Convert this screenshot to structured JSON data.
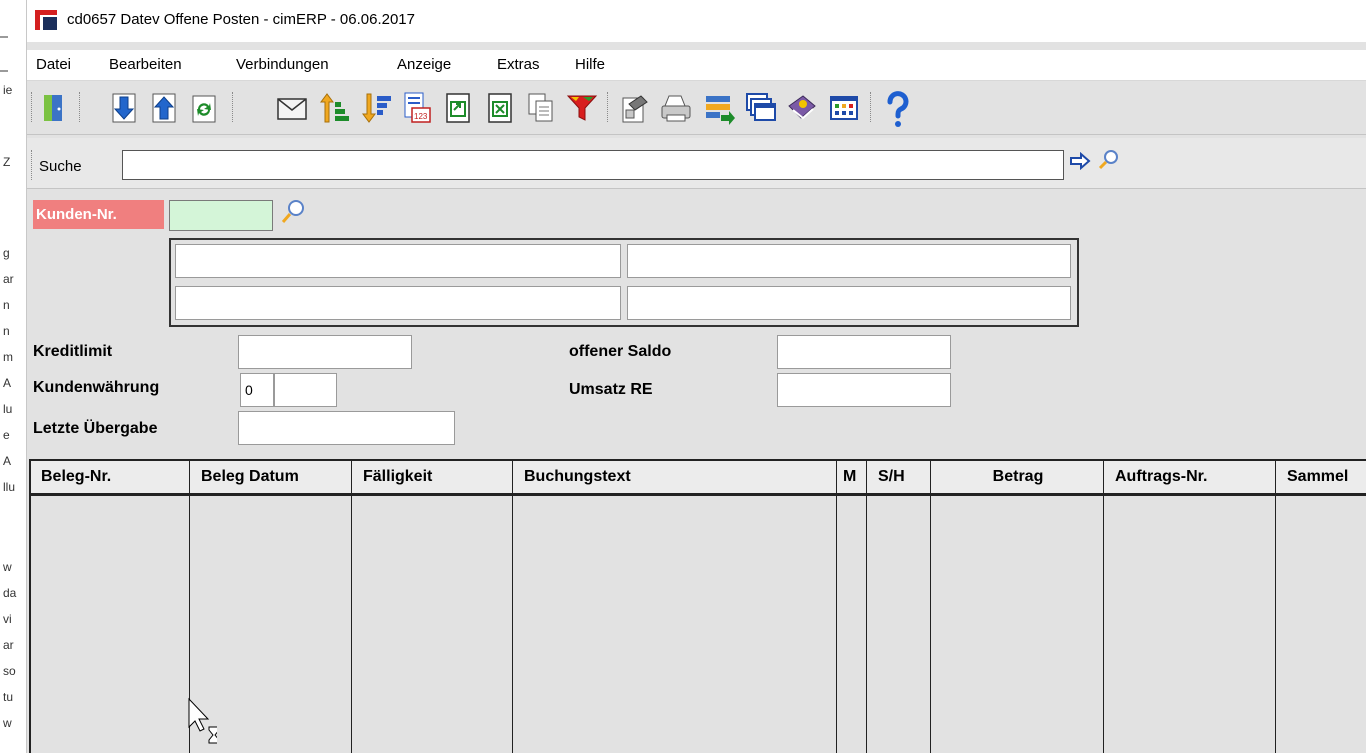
{
  "window": {
    "title": "cd0657 Datev Offene Posten - cimERP - 06.06.2017"
  },
  "menu": [
    "Datei",
    "Bearbeiten",
    "Verbindungen",
    "Anzeige",
    "Extras",
    "Hilfe"
  ],
  "toolbar": {
    "icons": [
      "exit-door-icon",
      "record-down-icon",
      "record-up-icon",
      "refresh-icon",
      "mail-icon",
      "sort-ascending-icon",
      "sort-descending-icon",
      "calendar-list-icon",
      "export-icon",
      "excel-export-icon",
      "copy-icon",
      "filter-icon",
      "properties-icon",
      "print-icon",
      "transfer-icon",
      "windows-icon",
      "book-icon",
      "table-icon",
      "help-icon"
    ]
  },
  "search": {
    "label": "Suche",
    "value": ""
  },
  "customer": {
    "number_label": "Kunden-Nr.",
    "number_value": ""
  },
  "fields": {
    "kreditlimit_label": "Kreditlimit",
    "kreditlimit_value": "",
    "waehrung_label": "Kundenwährung",
    "waehrung_code": "0",
    "waehrung_name": "",
    "letzte_label": "Letzte Übergabe",
    "letzte_value": "",
    "saldo_label": "offener Saldo",
    "saldo_value": "",
    "umsatz_label": "Umsatz RE",
    "umsatz_value": ""
  },
  "table": {
    "columns": [
      "Beleg-Nr.",
      "Beleg Datum",
      "Fälligkeit",
      "Buchungstext",
      "M",
      "S/H",
      "Betrag",
      "Auftrags-Nr.",
      "Sammel"
    ],
    "rows": []
  },
  "background_window": {
    "text": [
      "ie",
      "Z",
      "g",
      "ar",
      "n",
      "n",
      "m",
      "A",
      "lu",
      "e",
      "A",
      "llu",
      "w",
      "da",
      "vi",
      "ar",
      "so",
      "tu",
      "w"
    ]
  },
  "colors": {
    "required_label": "#f07f7f",
    "customer_field": "#d4f5d8",
    "app_background": "#e2e2e2"
  }
}
